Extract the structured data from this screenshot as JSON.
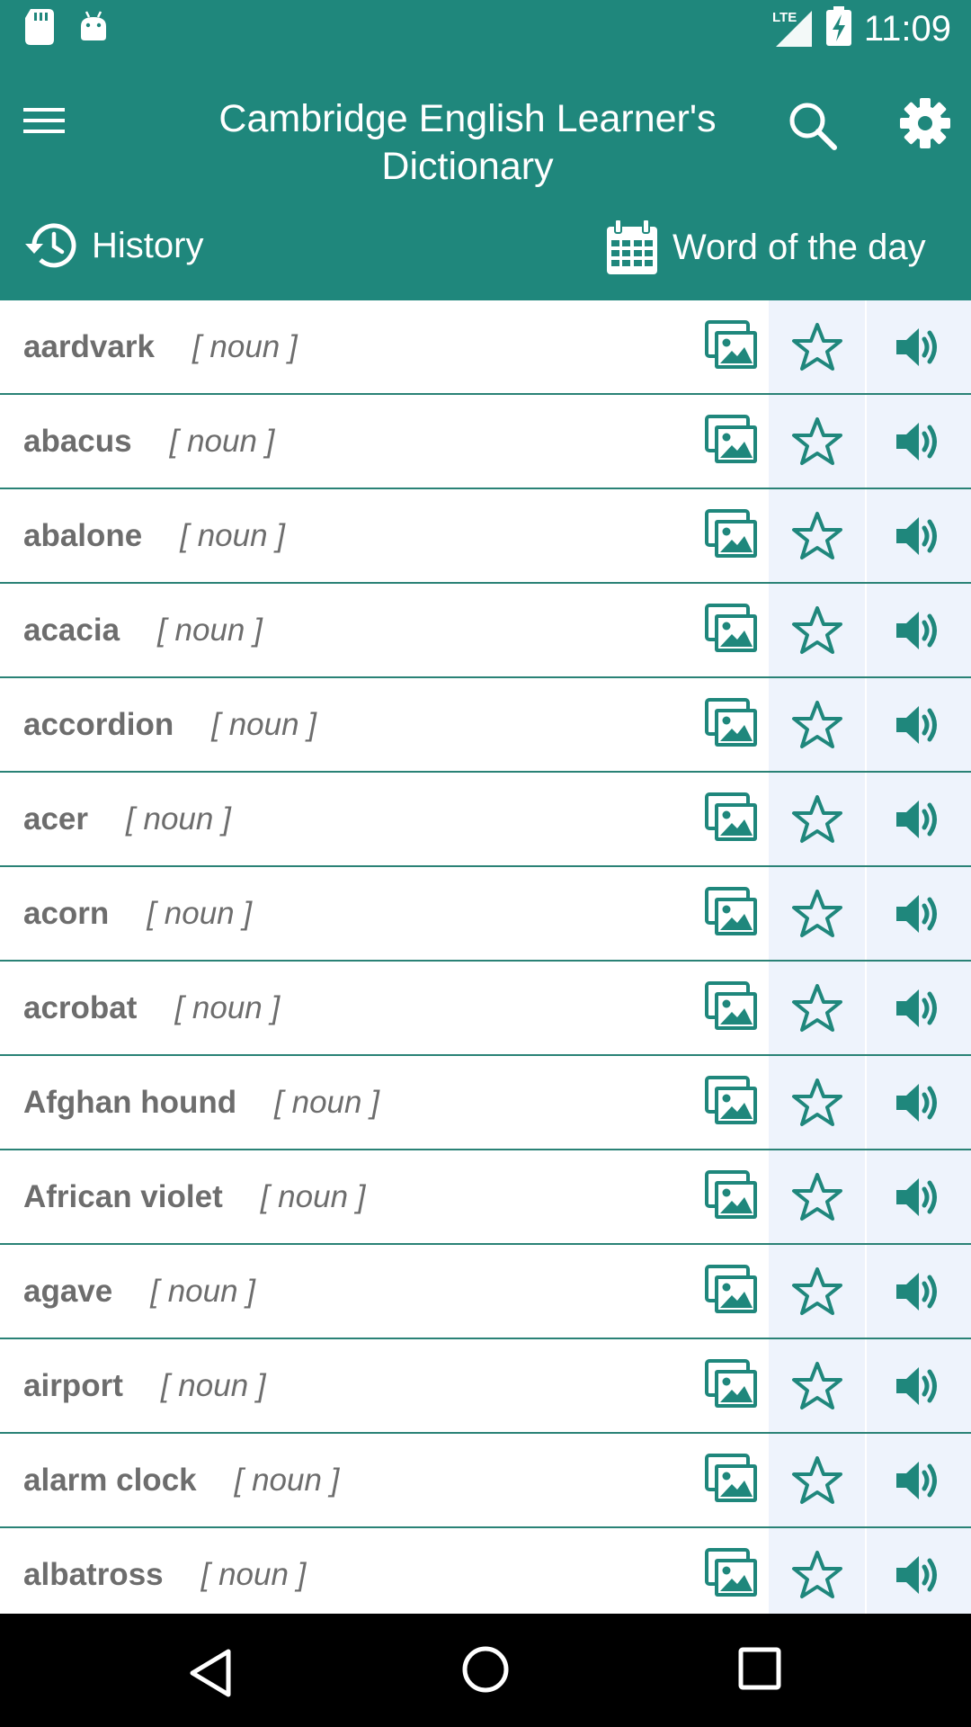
{
  "colors": {
    "primary": "#1f877c",
    "cell_bg": "#eef3fc",
    "text": "#6d6d6d",
    "icon": "#1f877c"
  },
  "status_bar": {
    "time": "11:09",
    "network": "LTE",
    "icons": [
      "sd-card-icon",
      "android-icon",
      "signal-icon",
      "battery-charging-icon"
    ]
  },
  "app_bar": {
    "title": "Cambridge English Learner's Dictionary",
    "menu_icon": "menu-icon",
    "search_icon": "search-icon",
    "settings_icon": "gear-icon",
    "history_label": "History",
    "word_of_day_label": "Word of the day"
  },
  "entries": [
    {
      "word": "aardvark",
      "pos": "[ noun ]"
    },
    {
      "word": "abacus",
      "pos": "[ noun ]"
    },
    {
      "word": "abalone",
      "pos": "[ noun ]"
    },
    {
      "word": "acacia",
      "pos": "[ noun ]"
    },
    {
      "word": "accordion",
      "pos": "[ noun ]"
    },
    {
      "word": "acer",
      "pos": "[ noun ]"
    },
    {
      "word": "acorn",
      "pos": "[ noun ]"
    },
    {
      "word": "acrobat",
      "pos": "[ noun ]"
    },
    {
      "word": "Afghan hound",
      "pos": "[ noun ]"
    },
    {
      "word": "African violet",
      "pos": "[ noun ]"
    },
    {
      "word": "agave",
      "pos": "[ noun ]"
    },
    {
      "word": "airport",
      "pos": "[ noun ]"
    },
    {
      "word": "alarm clock",
      "pos": "[ noun ]"
    },
    {
      "word": "albatross",
      "pos": "[ noun ]"
    }
  ],
  "nav_bar": {
    "icons": [
      "back-icon",
      "home-icon",
      "recents-icon"
    ]
  }
}
